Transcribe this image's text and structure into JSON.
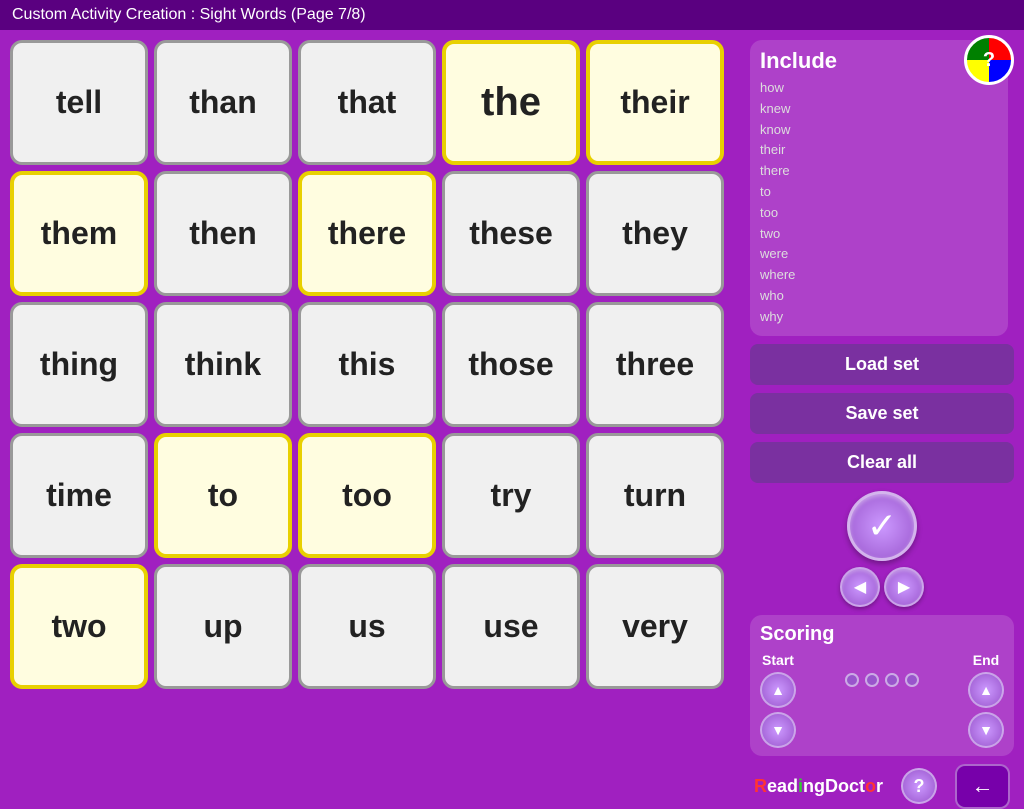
{
  "header": {
    "title": "Custom Activity Creation : Sight Words (Page 7/8)"
  },
  "grid": {
    "rows": [
      [
        {
          "word": "tell",
          "selected": false
        },
        {
          "word": "than",
          "selected": false
        },
        {
          "word": "that",
          "selected": false
        },
        {
          "word": "the",
          "selected": true,
          "large": true
        },
        {
          "word": "their",
          "selected": true
        }
      ],
      [
        {
          "word": "them",
          "selected": true
        },
        {
          "word": "then",
          "selected": false
        },
        {
          "word": "there",
          "selected": true
        },
        {
          "word": "these",
          "selected": false
        },
        {
          "word": "they",
          "selected": false
        }
      ],
      [
        {
          "word": "thing",
          "selected": false
        },
        {
          "word": "think",
          "selected": false
        },
        {
          "word": "this",
          "selected": false
        },
        {
          "word": "those",
          "selected": false
        },
        {
          "word": "three",
          "selected": false
        }
      ],
      [
        {
          "word": "time",
          "selected": false
        },
        {
          "word": "to",
          "selected": true
        },
        {
          "word": "too",
          "selected": true
        },
        {
          "word": "try",
          "selected": false
        },
        {
          "word": "turn",
          "selected": false
        }
      ],
      [
        {
          "word": "two",
          "selected": true
        },
        {
          "word": "up",
          "selected": false
        },
        {
          "word": "us",
          "selected": false
        },
        {
          "word": "use",
          "selected": false
        },
        {
          "word": "very",
          "selected": false
        }
      ]
    ]
  },
  "sidebar": {
    "include_title": "Include",
    "include_words": [
      "how",
      "knew",
      "know",
      "their",
      "there",
      "to",
      "too",
      "two",
      "were",
      "where",
      "who",
      "why"
    ],
    "load_set_label": "Load set",
    "save_set_label": "Save set",
    "clear_all_label": "Clear all",
    "scoring_title": "Scoring",
    "start_label": "Start",
    "end_label": "End",
    "dots_count": 4
  },
  "icons": {
    "checkmark": "✓",
    "arrow_left": "◀",
    "arrow_right": "▶",
    "arrow_back": "←",
    "question": "?",
    "logo_question": "?"
  }
}
